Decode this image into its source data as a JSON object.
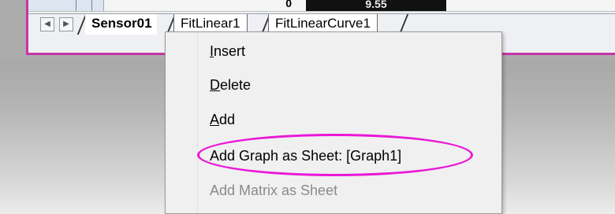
{
  "sheet_preview": {
    "cell_value_left": "0",
    "cell_value_dark": "9.55"
  },
  "tabs": [
    {
      "label": "Sensor01",
      "active": true
    },
    {
      "label": "FitLinear1",
      "active": false
    },
    {
      "label": "FitLinearCurve1",
      "active": false
    }
  ],
  "nav": {
    "prev_icon": "triangle-left",
    "next_icon": "triangle-right"
  },
  "context_menu": {
    "items": [
      {
        "prefix": "",
        "accel": "I",
        "rest": "nsert",
        "enabled": true
      },
      {
        "prefix": "",
        "accel": "D",
        "rest": "elete",
        "enabled": true
      },
      {
        "prefix": "",
        "accel": "A",
        "rest": "dd",
        "enabled": true
      },
      {
        "prefix": "Add Graph as Sheet: [Graph1]",
        "accel": "",
        "rest": "",
        "enabled": true
      },
      {
        "prefix": "Add Matrix as Sheet",
        "accel": "",
        "rest": "",
        "enabled": false
      }
    ]
  },
  "colors": {
    "workbook_border": "#c735a6",
    "highlight": "#ea17d7"
  }
}
